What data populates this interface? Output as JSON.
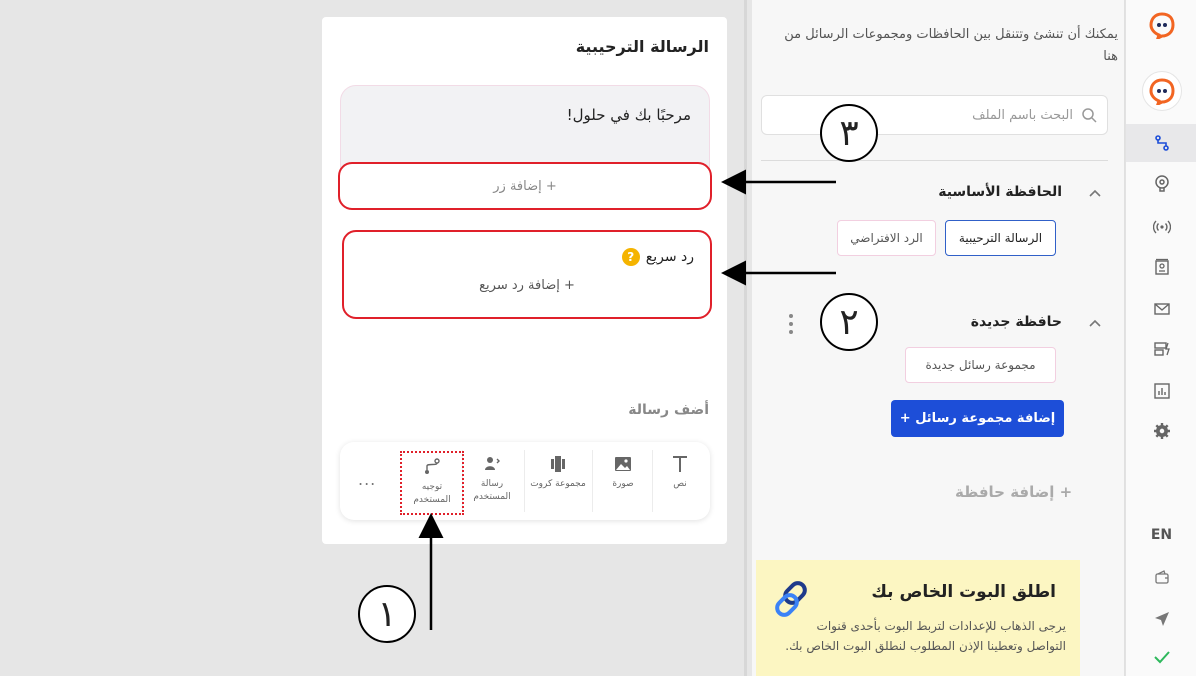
{
  "rail": {
    "lang_label": "EN"
  },
  "sidebar": {
    "description": "يمكنك أن تنشئ وتتنقل بين الحافظات ومجموعات الرسائل من هنا",
    "search_placeholder": "البحث باسم الملف",
    "folders": [
      {
        "title": "الحافظة الأساسية",
        "chips": [
          "الرسالة الترحيبية",
          "الرد الافتراضي"
        ]
      },
      {
        "title": "حافظة جديدة",
        "chips": [
          "مجموعة رسائل جديدة"
        ]
      }
    ],
    "add_group_button": "إضافة مجموعة رسائل +",
    "add_folder": "+ إضافة حافظة",
    "promo": {
      "title": "اطلق البوت الخاص بك",
      "text": "يرجى الذهاب للإعدادات لتربط البوت بأحدى قنوات التواصل وتعطينا الإذن المطلوب لنطلق البوت الخاص بك."
    }
  },
  "editor": {
    "title": "الرسالة الترحيبية",
    "bubble_text": "مرحبًا بك في حلول!",
    "add_button": "+ إضافة زر",
    "quick_reply": {
      "title": "رد سريع",
      "badge": "?",
      "add": "+ إضافة رد سريع"
    },
    "add_message_label": "أضف رسالة",
    "tools": [
      {
        "label": "نص",
        "icon": "text-icon"
      },
      {
        "label": "صورة",
        "icon": "image-icon"
      },
      {
        "label": "مجموعة كروت",
        "icon": "cards-icon"
      },
      {
        "label": "رسالة المستخدم",
        "icon": "user-message-icon"
      },
      {
        "label": "توجيه المستخدم",
        "icon": "route-icon"
      }
    ],
    "more": "..."
  },
  "annotations": {
    "one": "١",
    "two": "٢",
    "three": "٣"
  },
  "colors": {
    "accent_blue": "#1d4ed8",
    "highlight_red": "#e0202a",
    "promo_bg": "#fcf6c2",
    "logo_orange": "#f26522"
  }
}
